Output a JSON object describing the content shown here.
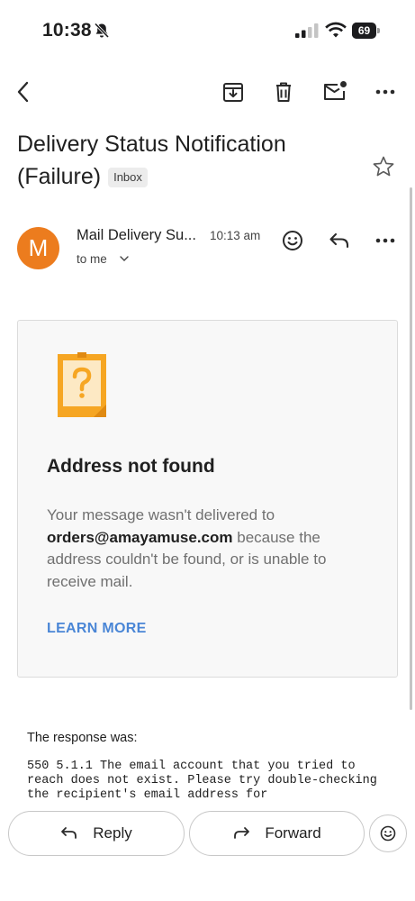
{
  "status_bar": {
    "time": "10:38",
    "battery_level": "69",
    "icons": [
      "bell-slash-icon",
      "signal-icon",
      "wifi-icon",
      "battery-icon"
    ]
  },
  "toolbar": {
    "icons": [
      "back-arrow-icon",
      "archive-icon",
      "trash-icon",
      "mark-unread-icon",
      "more-icon"
    ]
  },
  "email": {
    "subject": "Delivery Status Notification (Failure)",
    "label": "Inbox",
    "sender_name": "Mail Delivery Su...",
    "time": "10:13 am",
    "recipient": "to me"
  },
  "card": {
    "title": "Address not found",
    "body_before": "Your message wasn't delivered to ",
    "email_address": "orders@amayamuse.com",
    "body_after": " because the address couldn't be found, or is unable to receive mail.",
    "link": "LEARN MORE"
  },
  "response": {
    "label": "The response was:",
    "text": "550 5.1.1 The email account that you tried to reach does not exist. Please try double-checking the recipient's email address for"
  },
  "actions": {
    "reply": "Reply",
    "forward": "Forward"
  },
  "colors": {
    "avatar": "#ec7c1e",
    "link": "#4a86d6",
    "doc_icon": "#f6a623"
  }
}
